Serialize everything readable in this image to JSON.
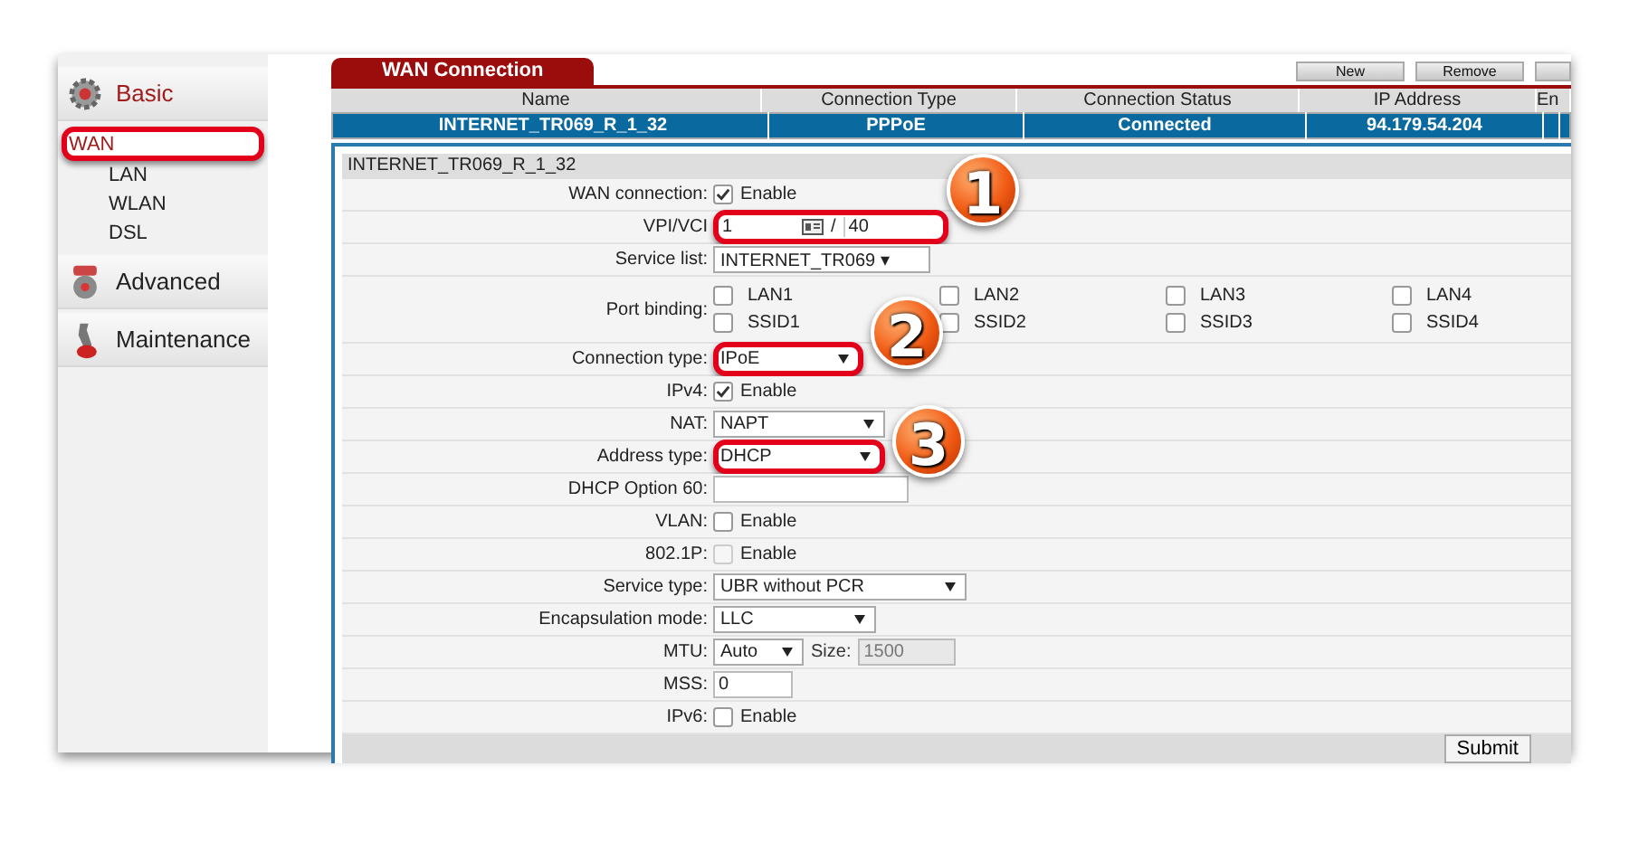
{
  "sidebar": {
    "sections": [
      {
        "kind": "gear",
        "title": "Basic",
        "selected": true,
        "items": [
          {
            "label": "WAN",
            "selected": true,
            "highlighted": true
          },
          {
            "label": "LAN",
            "selected": false,
            "highlighted": false
          },
          {
            "label": "WLAN",
            "selected": false,
            "highlighted": false
          },
          {
            "label": "DSL",
            "selected": false,
            "highlighted": false
          }
        ]
      },
      {
        "kind": "tools",
        "title": "Advanced",
        "selected": false
      },
      {
        "kind": "wrench",
        "title": "Maintenance",
        "selected": false
      }
    ]
  },
  "tab": {
    "label": "WAN Connection"
  },
  "toolbar": {
    "buttons": [
      "New",
      "Remove"
    ]
  },
  "table": {
    "columns": [
      "Name",
      "Connection Type",
      "Connection Status",
      "IP Address",
      "En"
    ],
    "rows": [
      {
        "selected": true,
        "cells": [
          "INTERNET_TR069_R_1_32",
          "PPPoE",
          "Connected",
          "94.179.54.204"
        ]
      }
    ]
  },
  "form": {
    "title": "INTERNET_TR069_R_1_32",
    "rows": [
      {
        "kind": "checkbox",
        "label": "WAN connection:",
        "text": "Enable",
        "checked": true,
        "disabled": false
      },
      {
        "kind": "vpi",
        "label": "VPI/VCI",
        "vpi": "1",
        "separator": "/",
        "vci": "40",
        "highlighted": true,
        "callout": "1"
      },
      {
        "kind": "select",
        "label": "Service list:",
        "value": "INTERNET_TR069 ▾",
        "highlighted": false
      },
      {
        "kind": "ports",
        "label": "Port binding:",
        "ports": [
          {
            "label": "LAN1",
            "checked": false
          },
          {
            "label": "LAN2",
            "checked": false
          },
          {
            "label": "LAN3",
            "checked": false
          },
          {
            "label": "LAN4",
            "checked": false
          },
          {
            "label": "SSID1",
            "checked": false
          },
          {
            "label": "SSID2",
            "checked": false
          },
          {
            "label": "SSID3",
            "checked": false
          },
          {
            "label": "SSID4",
            "checked": false
          }
        ]
      },
      {
        "kind": "select",
        "label": "Connection type:",
        "value": "IPoE",
        "highlighted": true,
        "callout": "2"
      },
      {
        "kind": "checkbox",
        "label": "IPv4:",
        "text": "Enable",
        "checked": true,
        "disabled": false
      },
      {
        "kind": "select",
        "label": "NAT:",
        "value": "NAPT",
        "highlighted": false
      },
      {
        "kind": "select",
        "label": "Address type:",
        "value": "DHCP",
        "highlighted": true,
        "callout": "3"
      },
      {
        "kind": "input",
        "label": "DHCP Option 60:",
        "value": ""
      },
      {
        "kind": "checkbox",
        "label": "VLAN:",
        "text": "Enable",
        "checked": false,
        "disabled": false
      },
      {
        "kind": "checkbox",
        "label": "802.1P:",
        "text": "Enable",
        "checked": false,
        "disabled": true
      },
      {
        "kind": "select",
        "label": "Service type:",
        "value": "UBR without PCR",
        "highlighted": false
      },
      {
        "kind": "select",
        "label": "Encapsulation mode:",
        "value": "LLC",
        "highlighted": false
      },
      {
        "kind": "mtu",
        "label": "MTU:",
        "value": "Auto",
        "size_label": "Size:",
        "size_value": "1500"
      },
      {
        "kind": "input",
        "label": "MSS:",
        "value": "0"
      },
      {
        "kind": "checkbox",
        "label": "IPv6:",
        "text": "Enable",
        "checked": false,
        "disabled": false
      }
    ],
    "submit": "Submit"
  }
}
